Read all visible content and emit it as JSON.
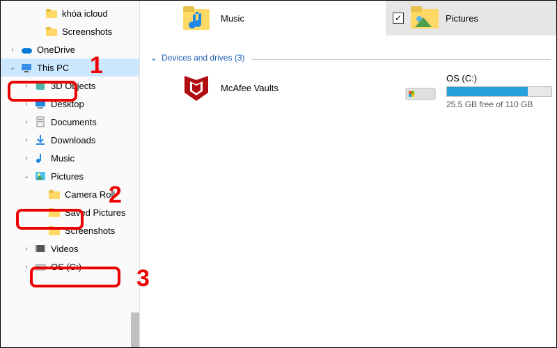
{
  "sidebar": {
    "items": [
      {
        "label": "khóa icloud",
        "icon": "folder",
        "expand": "",
        "indent": 46
      },
      {
        "label": "Screenshots",
        "icon": "folder",
        "expand": "",
        "indent": 46
      },
      {
        "label": "OneDrive",
        "icon": "onedrive",
        "expand": "right",
        "indent": 10
      },
      {
        "label": "This PC",
        "icon": "pc",
        "expand": "down",
        "indent": 10,
        "selected": true
      },
      {
        "label": "3D Objects",
        "icon": "3d",
        "expand": "right",
        "indent": 30
      },
      {
        "label": "Desktop",
        "icon": "desktop",
        "expand": "right",
        "indent": 30
      },
      {
        "label": "Documents",
        "icon": "documents",
        "expand": "right",
        "indent": 30
      },
      {
        "label": "Downloads",
        "icon": "downloads",
        "expand": "right",
        "indent": 30
      },
      {
        "label": "Music",
        "icon": "music",
        "expand": "right",
        "indent": 30
      },
      {
        "label": "Pictures",
        "icon": "pictures",
        "expand": "down",
        "indent": 30
      },
      {
        "label": "Camera Roll",
        "icon": "folder",
        "expand": "",
        "indent": 50
      },
      {
        "label": "Saved Pictures",
        "icon": "folder",
        "expand": "",
        "indent": 50
      },
      {
        "label": "Screenshots",
        "icon": "folder",
        "expand": "",
        "indent": 50
      },
      {
        "label": "Videos",
        "icon": "videos",
        "expand": "right",
        "indent": 30
      },
      {
        "label": "OS (C:)",
        "icon": "drive",
        "expand": "right",
        "indent": 30
      }
    ]
  },
  "main": {
    "music_label": "Music",
    "section_header": "Devices and drives (3)",
    "mcafee_label": "McAfee Vaults",
    "drive": {
      "label": "OS (C:)",
      "free_text": "25.5 GB free of 110 GB",
      "fill_percent": 77
    },
    "thumb_label": "Pictures"
  },
  "annotations": {
    "n1": "1",
    "n2": "2",
    "n3": "3"
  }
}
